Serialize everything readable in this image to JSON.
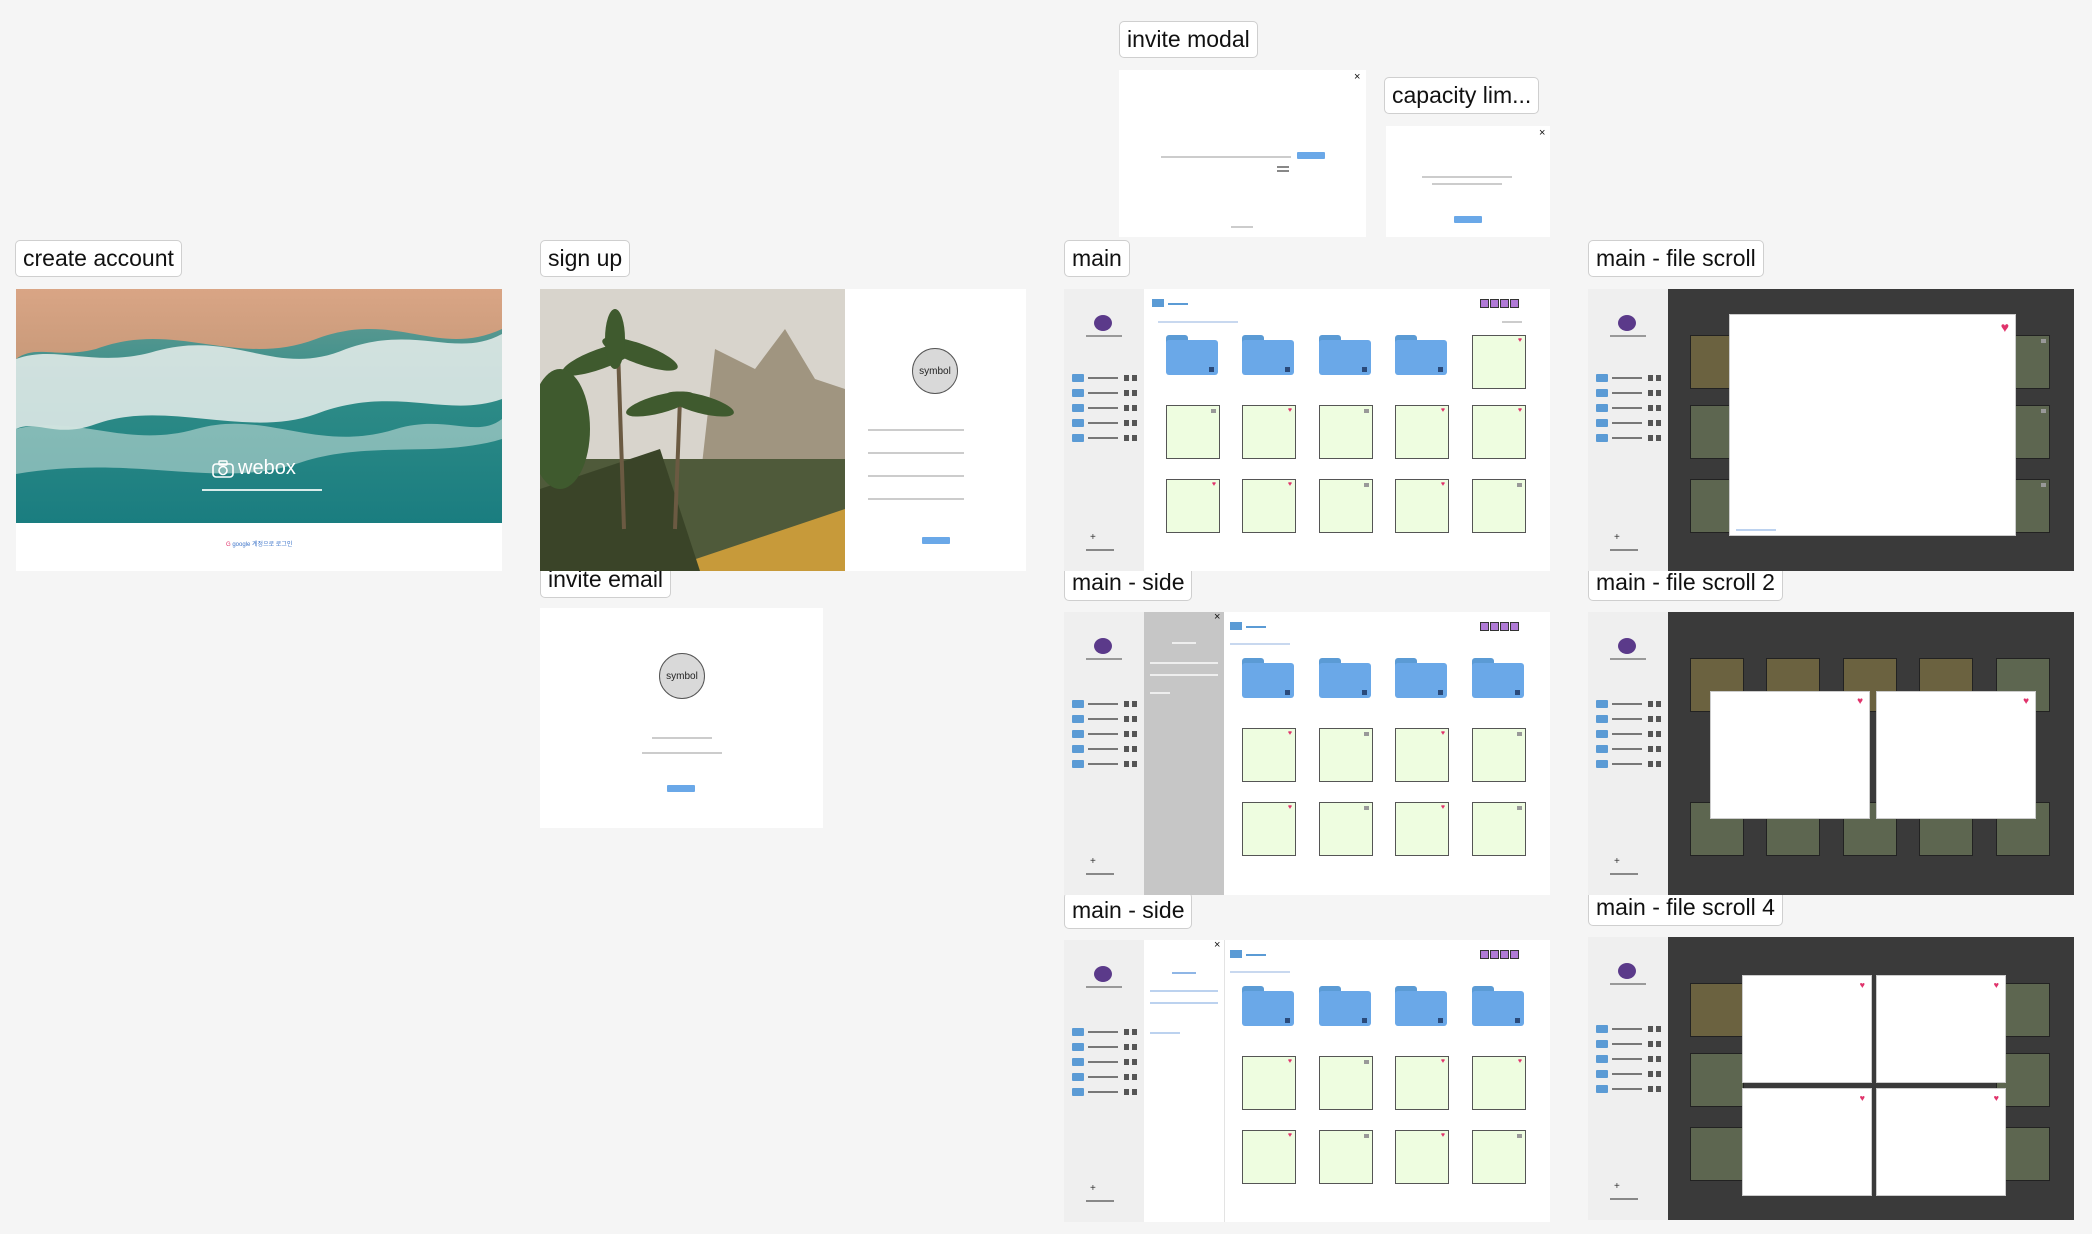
{
  "frames": {
    "create_account": {
      "label": "create account",
      "brand": "webox",
      "login_text": "google 계정으로 로그인"
    },
    "sign_up": {
      "label": "sign up",
      "symbol": "symbol"
    },
    "invite_email": {
      "label": "invite email",
      "symbol": "symbol"
    },
    "invite_modal": {
      "label": "invite modal"
    },
    "capacity_limit": {
      "label": "capacity lim..."
    },
    "main": {
      "label": "main"
    },
    "main_side_1": {
      "label": "main - side"
    },
    "main_side_2": {
      "label": "main - side"
    },
    "file_scroll": {
      "label": "main - file scroll"
    },
    "file_scroll_2": {
      "label": "main - file scroll 2"
    },
    "file_scroll_4": {
      "label": "main - file scroll 4"
    }
  },
  "icons": {
    "close": "×",
    "heart": "♥",
    "add": "+"
  },
  "colors": {
    "accent": "#6aa8e8",
    "folder": "#5b9bd5",
    "card": "#eefde0",
    "heart": "#e0336b",
    "topbar_button": "#b07ad6"
  }
}
